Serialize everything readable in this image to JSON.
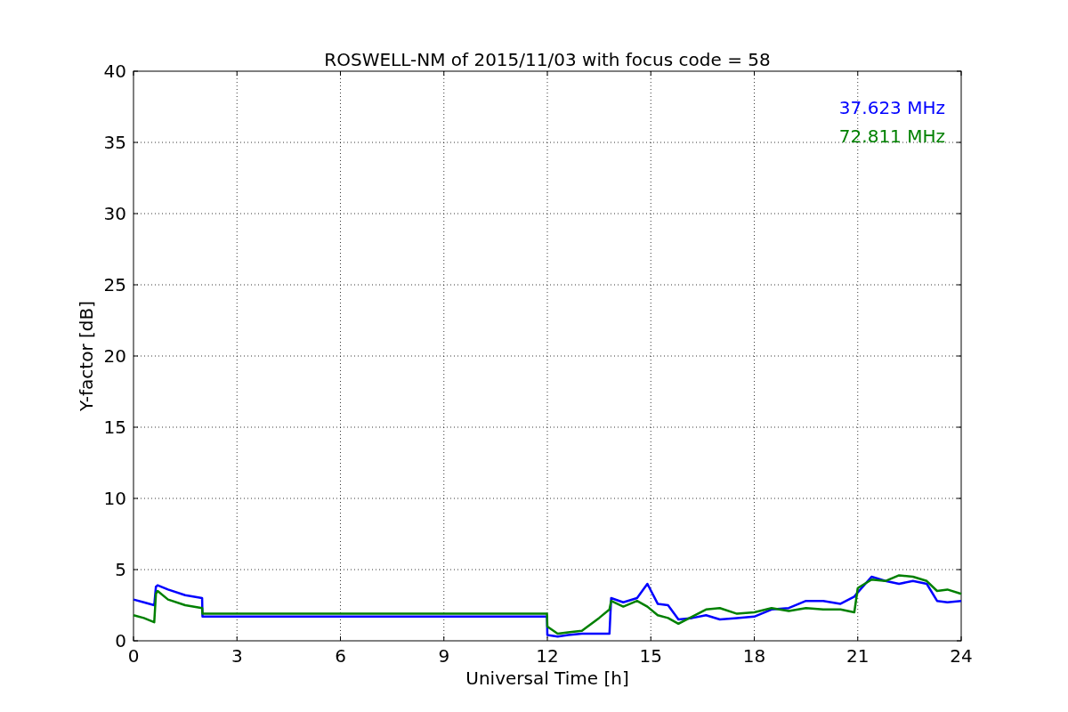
{
  "chart_data": {
    "type": "line",
    "title": "ROSWELL-NM of 2015/11/03 with focus code = 58",
    "xlabel": "Universal Time [h]",
    "ylabel": "Y-factor [dB]",
    "x": [
      0,
      0.3,
      0.6,
      0.65,
      0.7,
      1,
      1.5,
      1.99,
      2,
      6,
      11.99,
      12,
      12.3,
      12.6,
      13,
      13.5,
      13.8,
      13.85,
      14.2,
      14.6,
      14.9,
      15.2,
      15.5,
      15.8,
      16.2,
      16.6,
      17,
      17.5,
      18,
      18.5,
      19,
      19.5,
      20,
      20.5,
      20.9,
      21,
      21.4,
      21.8,
      22.2,
      22.6,
      23,
      23.3,
      23.6,
      24
    ],
    "series": [
      {
        "name": "37.623 MHz",
        "color": "#0000ff",
        "values": [
          2.9,
          2.7,
          2.5,
          3.8,
          3.9,
          3.6,
          3.2,
          3.0,
          1.7,
          1.7,
          1.7,
          0.4,
          0.3,
          0.4,
          0.5,
          0.5,
          0.5,
          3.0,
          2.7,
          3.0,
          4.0,
          2.6,
          2.5,
          1.5,
          1.6,
          1.8,
          1.5,
          1.6,
          1.7,
          2.2,
          2.3,
          2.8,
          2.8,
          2.6,
          3.1,
          3.4,
          4.5,
          4.2,
          4.0,
          4.2,
          4.0,
          2.8,
          2.7,
          2.8
        ]
      },
      {
        "name": "72.811 MHz",
        "color": "#008000",
        "values": [
          1.8,
          1.6,
          1.3,
          3.3,
          3.5,
          2.9,
          2.5,
          2.3,
          1.9,
          1.9,
          1.9,
          1.0,
          0.5,
          0.6,
          0.7,
          1.6,
          2.2,
          2.8,
          2.4,
          2.8,
          2.4,
          1.8,
          1.6,
          1.2,
          1.7,
          2.2,
          2.3,
          1.9,
          2.0,
          2.3,
          2.1,
          2.3,
          2.2,
          2.2,
          2.0,
          3.7,
          4.3,
          4.2,
          4.6,
          4.5,
          4.2,
          3.5,
          3.6,
          3.3
        ]
      }
    ],
    "xlim": [
      0,
      24
    ],
    "ylim": [
      0,
      40
    ],
    "xticks": [
      0,
      3,
      6,
      9,
      12,
      15,
      18,
      21,
      24
    ],
    "yticks": [
      0,
      5,
      10,
      15,
      20,
      25,
      30,
      35,
      40
    ],
    "grid": true
  }
}
